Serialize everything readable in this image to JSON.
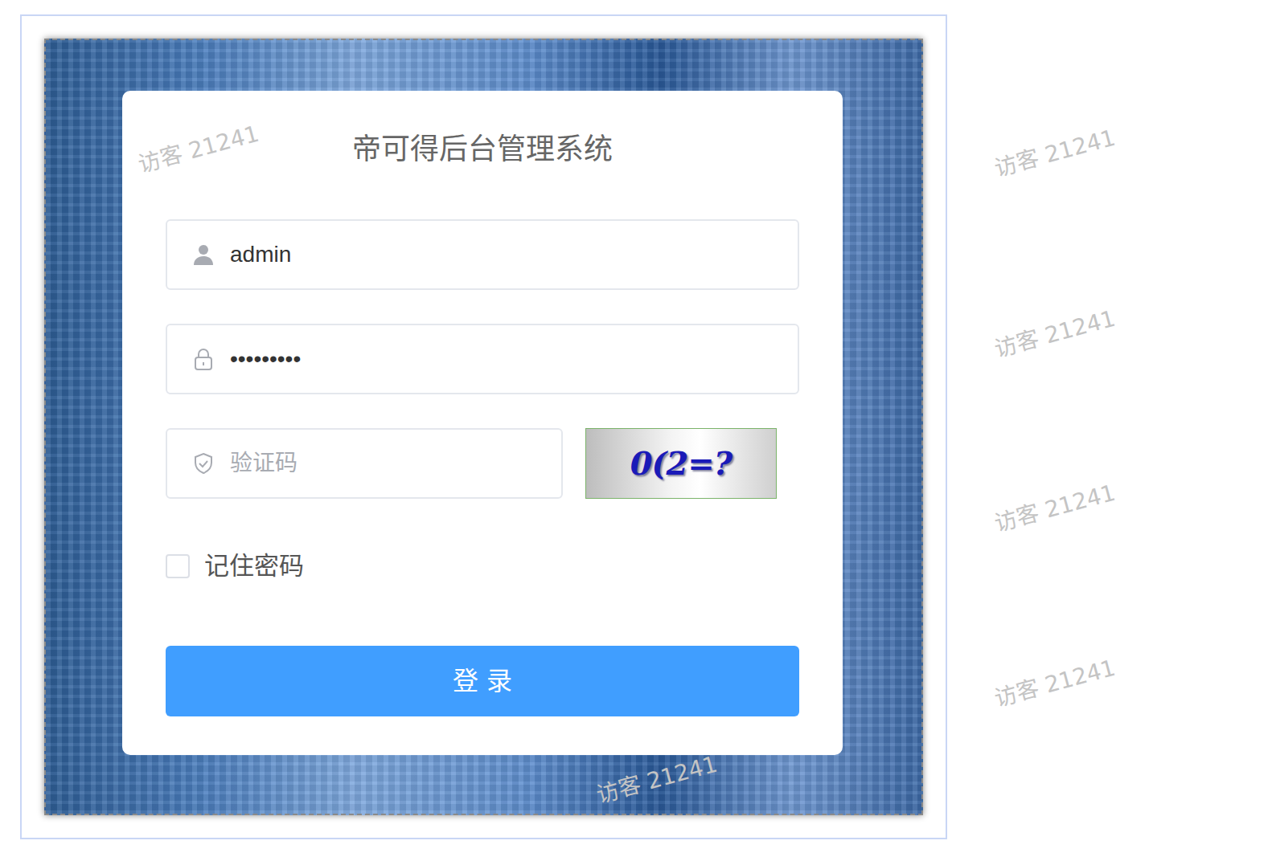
{
  "title": "帝可得后台管理系统",
  "username": {
    "value": "admin"
  },
  "password": {
    "value": "•••••••••"
  },
  "captcha": {
    "placeholder": "验证码",
    "image_text": "0(2=?"
  },
  "remember": {
    "label": "记住密码",
    "checked": false
  },
  "login_button": "登 录",
  "watermark": "访客 21241"
}
